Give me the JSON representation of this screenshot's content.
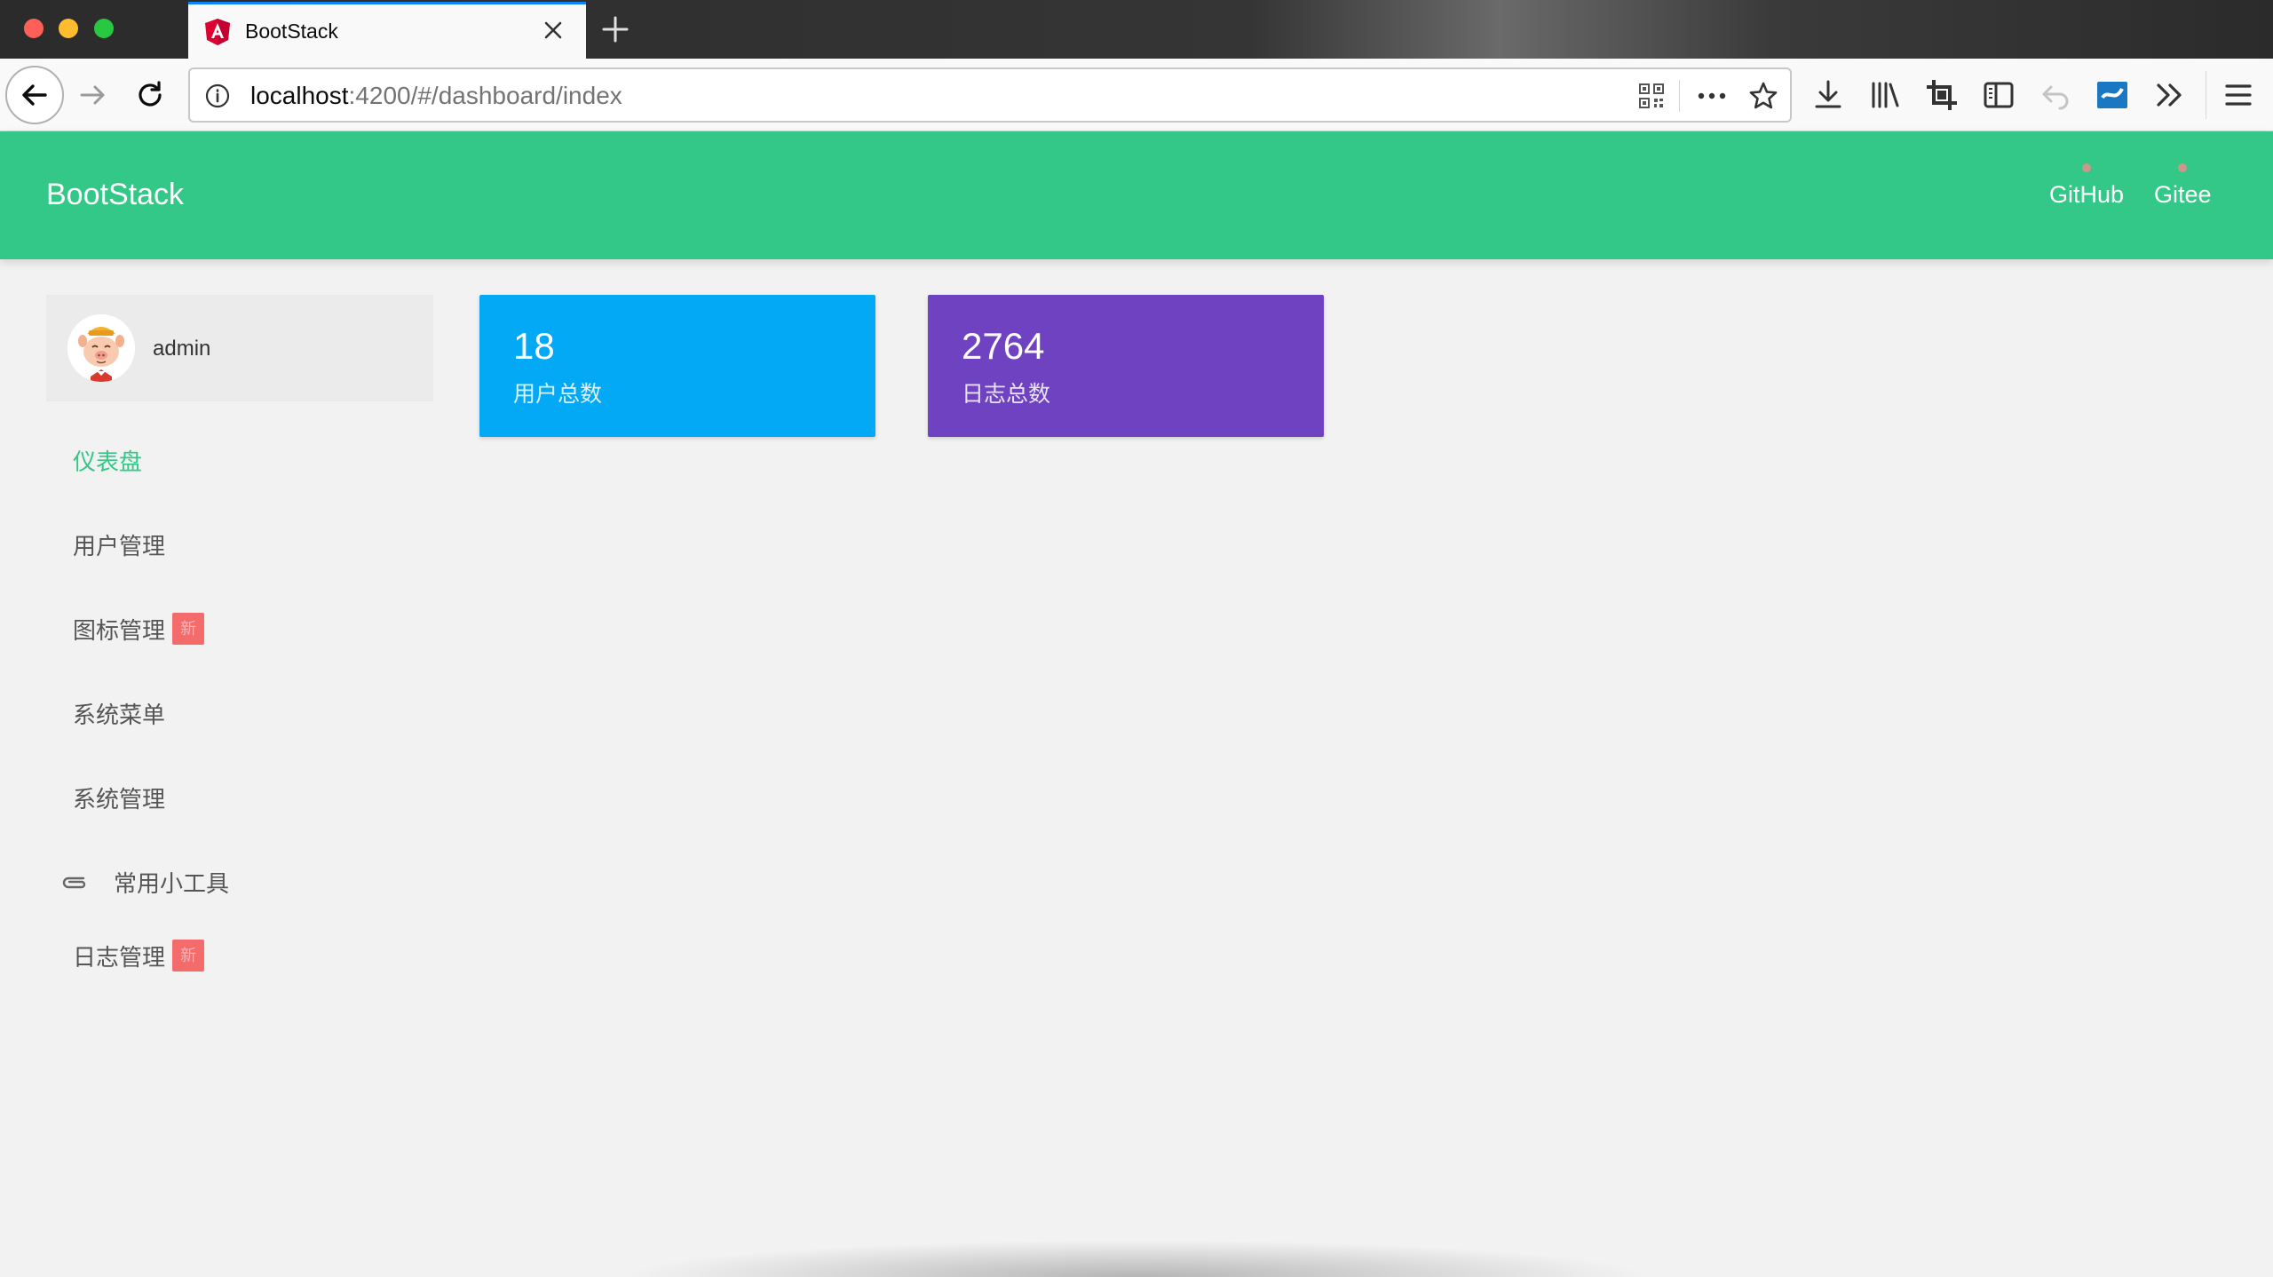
{
  "browser": {
    "tab_title": "BootStack",
    "url_host": "localhost",
    "url_path": ":4200/#/dashboard/index"
  },
  "app": {
    "brand": "BootStack",
    "links": [
      {
        "label": "GitHub"
      },
      {
        "label": "Gitee"
      }
    ],
    "colors": {
      "header": "#33c887",
      "users_card": "#03a9f4",
      "logs_card": "#6f42c1",
      "badge": "#f36b6b"
    }
  },
  "user": {
    "name": "admin"
  },
  "menu": [
    {
      "label": "仪表盘",
      "active": true
    },
    {
      "label": "用户管理"
    },
    {
      "label": "图标管理",
      "badge": "新"
    },
    {
      "label": "系统菜单"
    },
    {
      "label": "系统管理"
    },
    {
      "label": "常用小工具",
      "icon": "paperclip-icon"
    },
    {
      "label": "日志管理",
      "badge": "新"
    }
  ],
  "stats": [
    {
      "value": "18",
      "label": "用户总数"
    },
    {
      "value": "2764",
      "label": "日志总数"
    }
  ]
}
